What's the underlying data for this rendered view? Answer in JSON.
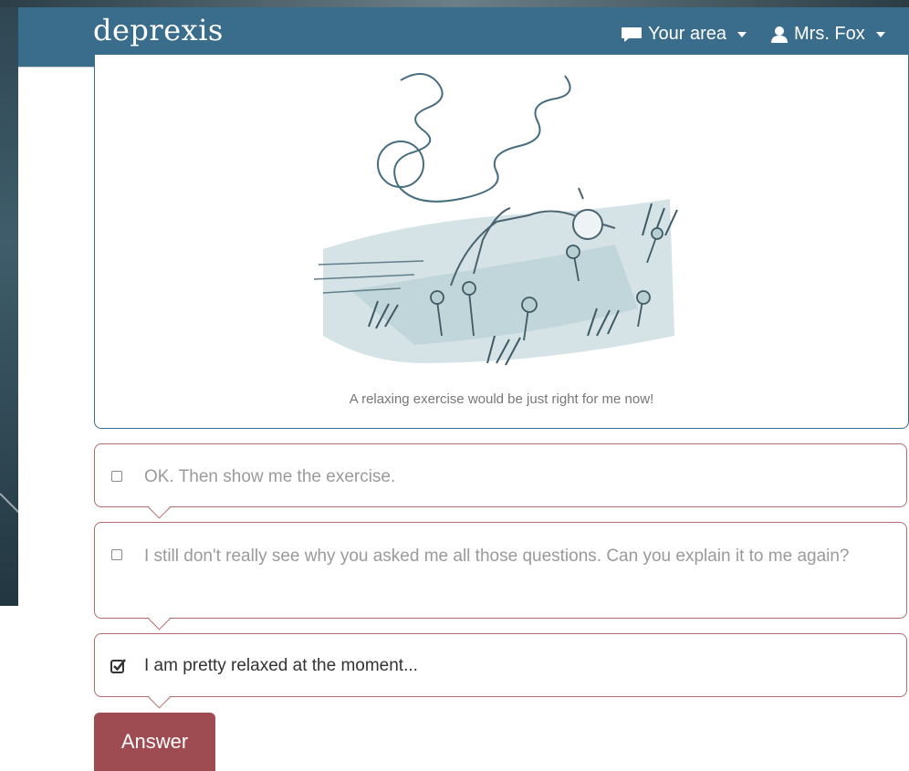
{
  "navbar": {
    "brand": "deprexis",
    "area_label": "Your area",
    "user_label": "Mrs. Fox",
    "bg_color": "#3a6c8b"
  },
  "card": {
    "caption": "A relaxing exercise would be just right for me now!"
  },
  "options": [
    {
      "label": "OK. Then show me the exercise.",
      "checked": false
    },
    {
      "label": "I still don't really see why you asked me all those questions. Can you explain it to me again?",
      "checked": false
    },
    {
      "label": "I am pretty relaxed at the moment...",
      "checked": true
    }
  ],
  "answer_button": {
    "label": "Answer",
    "color": "#9e4b52"
  },
  "icons": {
    "area": "chat-bubble-icon",
    "user": "person-icon",
    "checked": "checked-box-icon"
  }
}
